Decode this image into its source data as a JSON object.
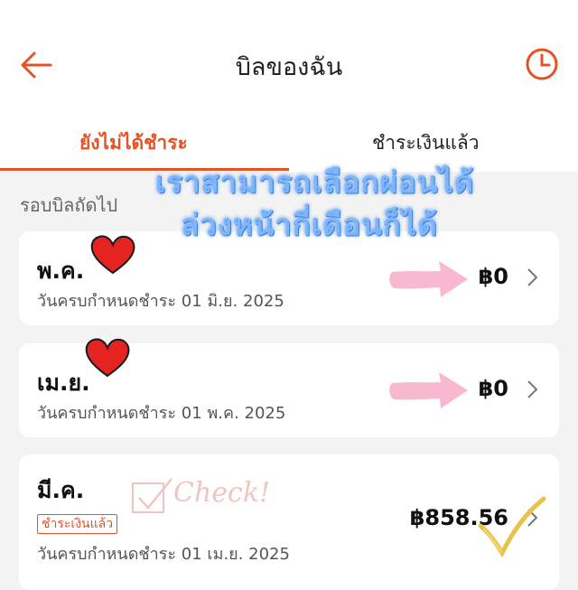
{
  "header": {
    "title": "บิลของฉัน",
    "back_icon": "arrow-left-icon",
    "history_icon": "clock-icon"
  },
  "tabs": [
    {
      "label": "ยังไม่ได้ชำระ",
      "active": true
    },
    {
      "label": "ชำระเงินแล้ว",
      "active": false
    }
  ],
  "section_label": "รอบบิลถัดไป",
  "bills": [
    {
      "month": "พ.ค.",
      "due": "วันครบกำหนดชำระ 01 มิ.ย. 2025",
      "amount": "฿0",
      "status": ""
    },
    {
      "month": "เม.ย.",
      "due": "วันครบกำหนดชำระ 01 พ.ค. 2025",
      "amount": "฿0",
      "status": ""
    },
    {
      "month": "มี.ค.",
      "due": "วันครบกำหนดชำระ 01 เม.ย. 2025",
      "amount": "฿858.56",
      "status": "ชำระเงินแล้ว"
    }
  ],
  "annotations": {
    "overlay_line_1": "เราสามารถเลือกผ่อนได้",
    "overlay_line_2": "ล่วงหน้ากี่เดือนก็ได้",
    "check_text": "Check!"
  },
  "colors": {
    "accent": "#e65125",
    "overlay_fill": "#7db6ff",
    "heart": "#e52421",
    "arrow_pink": "#f7b8d0"
  }
}
